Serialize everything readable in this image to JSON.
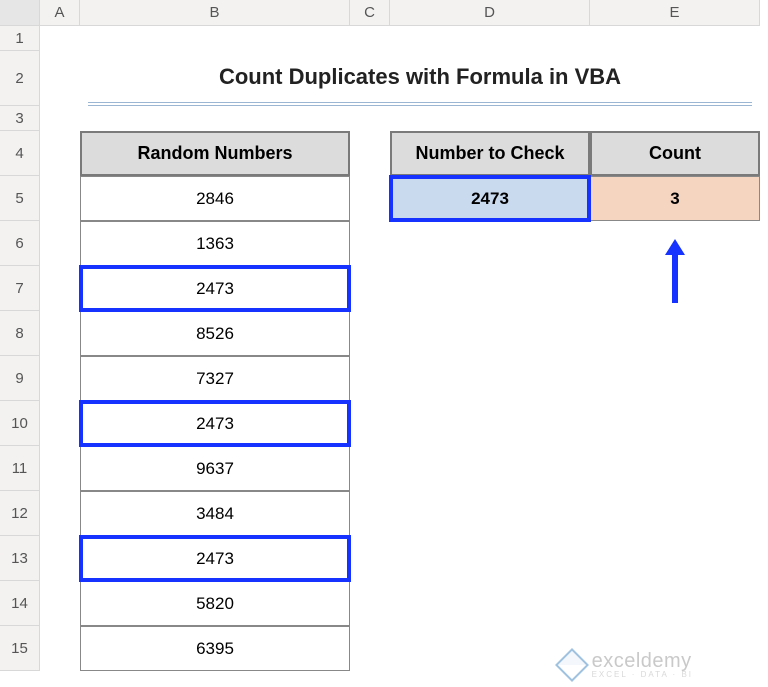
{
  "cols": [
    "A",
    "B",
    "C",
    "D",
    "E"
  ],
  "rows": [
    "1",
    "2",
    "3",
    "4",
    "5",
    "6",
    "7",
    "8",
    "9",
    "10",
    "11",
    "12",
    "13",
    "14",
    "15"
  ],
  "title": "Count Duplicates with Formula in VBA",
  "random_header": "Random Numbers",
  "random_values": [
    "2846",
    "1363",
    "2473",
    "8526",
    "7327",
    "2473",
    "9637",
    "3484",
    "2473",
    "5820",
    "6395"
  ],
  "highlight_indices": [
    2,
    5,
    8
  ],
  "check_header": "Number to Check",
  "count_header": "Count",
  "check_value": "2473",
  "count_value": "3",
  "watermark": {
    "brand": "exceldemy",
    "sub": "EXCEL · DATA · BI"
  }
}
